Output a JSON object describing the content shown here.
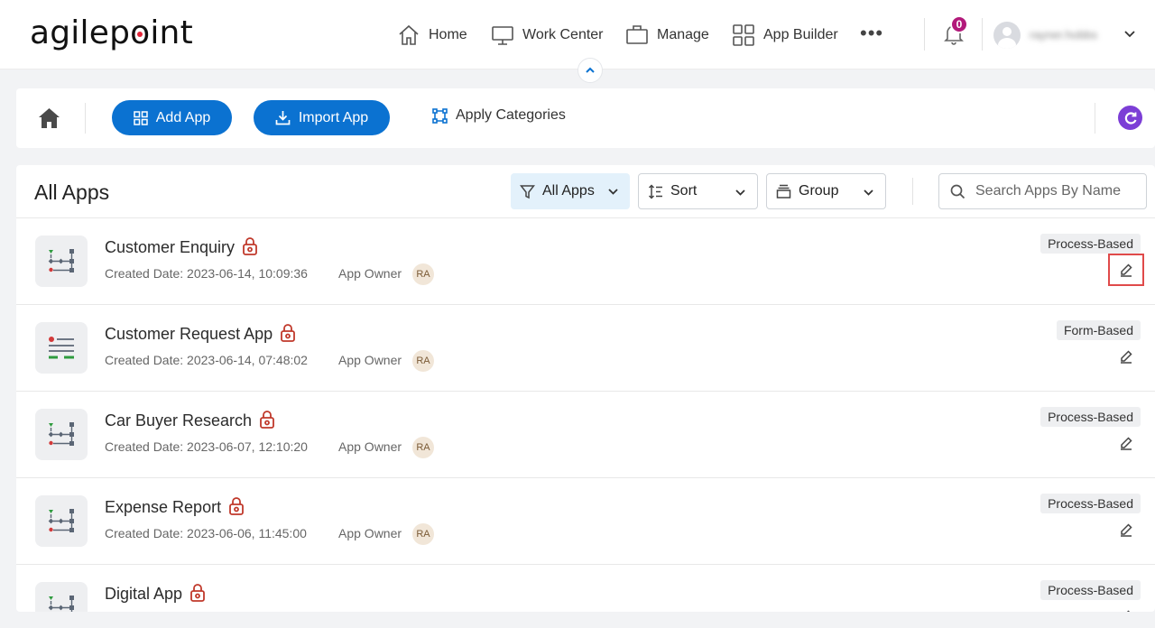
{
  "nav": {
    "logo_text": "agilepoint",
    "items": [
      {
        "label": "Home",
        "icon": "home-icon"
      },
      {
        "label": "Work Center",
        "icon": "monitor-icon"
      },
      {
        "label": "Manage",
        "icon": "briefcase-icon"
      },
      {
        "label": "App Builder",
        "icon": "grid-icon"
      }
    ],
    "more": "•••",
    "notifications_count": "0",
    "username": "rayner.hobbs"
  },
  "toolbar": {
    "add_app": "Add App",
    "import_app": "Import App",
    "apply_categories": "Apply Categories"
  },
  "main": {
    "title": "All Apps",
    "filter_label": "All Apps",
    "sort_label": "Sort",
    "group_label": "Group",
    "search_placeholder": "Search Apps By Name"
  },
  "apps": [
    {
      "name": "Customer Enquiry",
      "created": "Created Date: 2023-06-14, 10:09:36",
      "owner_label": "App Owner",
      "owner_initials": "RA",
      "type": "Process-Based",
      "icon": "process-icon",
      "edit_highlighted": true
    },
    {
      "name": "Customer Request App",
      "created": "Created Date: 2023-06-14, 07:48:02",
      "owner_label": "App Owner",
      "owner_initials": "RA",
      "type": "Form-Based",
      "icon": "form-icon",
      "edit_highlighted": false
    },
    {
      "name": "Car Buyer Research",
      "created": "Created Date: 2023-06-07, 12:10:20",
      "owner_label": "App Owner",
      "owner_initials": "RA",
      "type": "Process-Based",
      "icon": "process-icon",
      "edit_highlighted": false
    },
    {
      "name": "Expense Report",
      "created": "Created Date: 2023-06-06, 11:45:00",
      "owner_label": "App Owner",
      "owner_initials": "RA",
      "type": "Process-Based",
      "icon": "process-icon",
      "edit_highlighted": false
    },
    {
      "name": "Digital App",
      "created": "",
      "owner_label": "",
      "owner_initials": "",
      "type": "Process-Based",
      "icon": "process-icon",
      "edit_highlighted": false
    }
  ],
  "colors": {
    "primary": "#0b72d1",
    "badge": "#b2197a",
    "lock": "#c0392b",
    "refresh": "#7c3ed6",
    "highlight": "#e04a4a"
  }
}
